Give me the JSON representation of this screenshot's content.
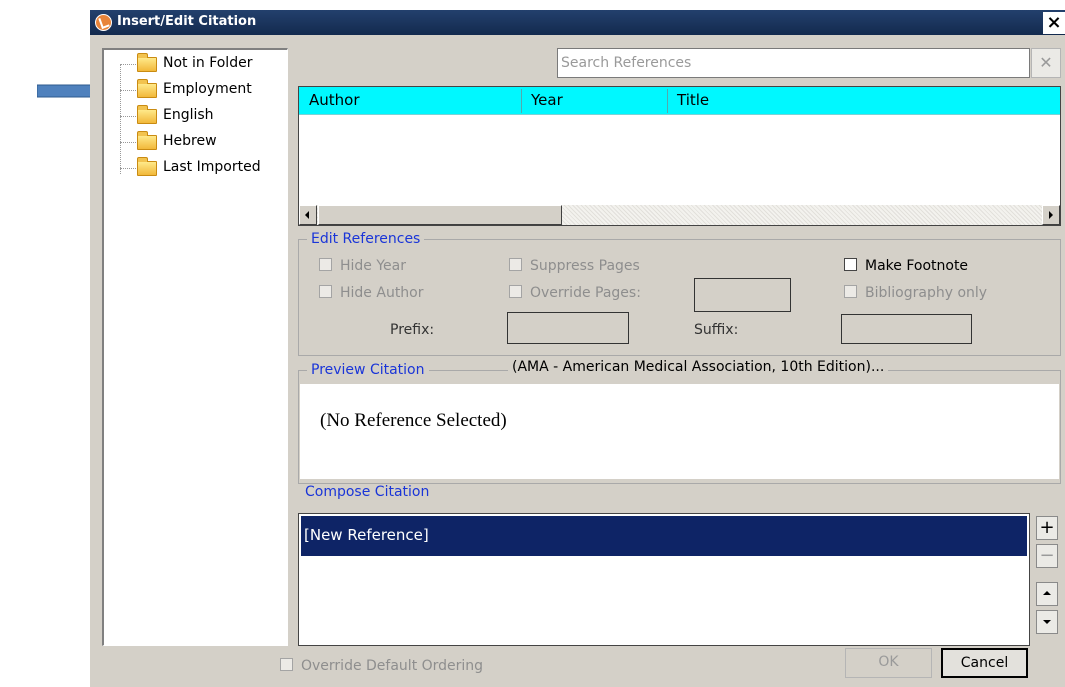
{
  "window": {
    "title": "Insert/Edit Citation",
    "close_glyph": "×"
  },
  "folders": [
    {
      "label": "Not in Folder",
      "icon": "folder-icon"
    },
    {
      "label": "Employment",
      "icon": "folder-icon"
    },
    {
      "label": "English",
      "icon": "folder-icon"
    },
    {
      "label": "Hebrew",
      "icon": "folder-icon"
    },
    {
      "label": "Last Imported",
      "icon": "folder-icon"
    }
  ],
  "search": {
    "placeholder": "Search References",
    "value": "",
    "clear_glyph": "✕"
  },
  "reference_table": {
    "header_color": "#00f8ff",
    "columns": [
      "Author",
      "Year",
      "Title"
    ],
    "rows": []
  },
  "edit_references": {
    "legend": "Edit References",
    "hide_year": "Hide Year",
    "hide_author": "Hide Author",
    "suppress_pages": "Suppress Pages",
    "override_pages": "Override Pages:",
    "make_footnote": "Make Footnote",
    "bibliography_only": "Bibliography only",
    "prefix_label": "Prefix:",
    "suffix_label": "Suffix:",
    "prefix_value": "",
    "suffix_value": ""
  },
  "preview": {
    "legend": "Preview Citation",
    "style_name": "(AMA - American Medical Association, 10th Edition)...",
    "text": "(No Reference Selected)"
  },
  "compose": {
    "label": "Compose Citation",
    "items": [
      "[New Reference]"
    ],
    "selected_color": "#0e2466"
  },
  "side_buttons": {
    "add": "+",
    "remove": "−",
    "up_icon": "arrow-up-icon",
    "down_icon": "arrow-down-icon"
  },
  "footer": {
    "override_ordering": "Override Default Ordering",
    "ok": "OK",
    "cancel": "Cancel"
  },
  "annotation": {
    "arrow_color": "#4f81bd",
    "arrow_target": "Employment"
  }
}
